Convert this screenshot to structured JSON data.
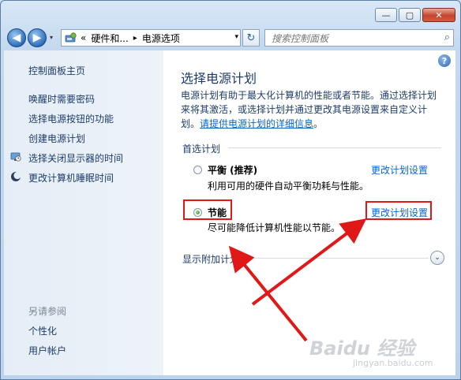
{
  "window": {
    "minimize_glyph": "—",
    "maximize_glyph": "▢",
    "close_glyph": "✕"
  },
  "navbar": {
    "back_glyph": "◀",
    "forward_glyph": "▶",
    "history_glyph": "▾",
    "breadcrumb_overflow": "«",
    "breadcrumb_1": "硬件和...",
    "breadcrumb_sep": "▸",
    "breadcrumb_2": "电源选项",
    "address_drop_glyph": "▾",
    "refresh_glyph": "↻",
    "search_placeholder": "搜索控制面板",
    "search_glyph": "⌕"
  },
  "sidebar": {
    "home": "控制面板主页",
    "links": [
      "唤醒时需要密码",
      "选择电源按钮的功能",
      "创建电源计划",
      "选择关闭显示器的时间",
      "更改计算机睡眠时间"
    ],
    "see_also_title": "另请参阅",
    "see_also_links": [
      "个性化",
      "用户帐户"
    ]
  },
  "main": {
    "help_glyph": "?",
    "title": "选择电源计划",
    "desc_line1": "电源计划有助于最大化计算机的性能或者节能。通过选择计划",
    "desc_line2": "来将其激活，或选择计划并通过更改其电源设置来自定义计",
    "desc_line3_prefix": "划。",
    "desc_link": "请提供电源计划的详细信息",
    "desc_line3_suffix": "。",
    "preferred_label": "首选计划",
    "plans": [
      {
        "name": "平衡 (推荐)",
        "description": "利用可用的硬件自动平衡功耗与性能。",
        "link": "更改计划设置",
        "selected": false
      },
      {
        "name": "节能",
        "description": "尽可能降低计算机性能以节能。",
        "link": "更改计划设置",
        "selected": true
      }
    ],
    "show_more_label": "显示附加计划",
    "expand_glyph": "⌄"
  },
  "colors": {
    "annotation_red": "#e01818",
    "link_blue": "#0a64c8",
    "heading_blue": "#1e3c6b"
  },
  "watermark": {
    "brand": "Baidu 经验",
    "url": "jingyan.baidu.com"
  }
}
